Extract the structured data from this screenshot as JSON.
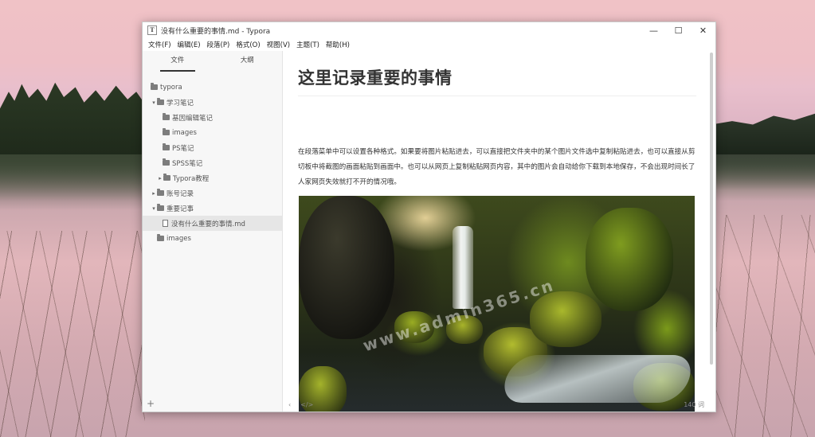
{
  "window": {
    "title": "没有什么重要的事情.md - Typora",
    "app_icon": "T",
    "controls": {
      "minimize": "—",
      "maximize": "☐",
      "close": "✕"
    }
  },
  "menu": [
    "文件(F)",
    "编辑(E)",
    "段落(P)",
    "格式(O)",
    "视图(V)",
    "主题(T)",
    "帮助(H)"
  ],
  "sidebar": {
    "tabs": [
      "文件",
      "大纲"
    ],
    "tree": [
      {
        "label": "typora",
        "level": 0,
        "caret": "",
        "type": "folder"
      },
      {
        "label": "学习笔记",
        "level": 1,
        "caret": "▾",
        "type": "folder"
      },
      {
        "label": "基因编辑笔记",
        "level": 2,
        "caret": "",
        "type": "folder"
      },
      {
        "label": "images",
        "level": 2,
        "caret": "",
        "type": "folder"
      },
      {
        "label": "PS笔记",
        "level": 2,
        "caret": "",
        "type": "folder"
      },
      {
        "label": "SPSS笔记",
        "level": 2,
        "caret": "",
        "type": "folder"
      },
      {
        "label": "Typora教程",
        "level": 2,
        "caret": "▸",
        "type": "folder"
      },
      {
        "label": "账号记录",
        "level": 1,
        "caret": "▸",
        "type": "folder"
      },
      {
        "label": "重要记事",
        "level": 1,
        "caret": "▾",
        "type": "folder"
      },
      {
        "label": "没有什么重要的事情.md",
        "level": 2,
        "caret": "",
        "type": "file",
        "selected": true
      },
      {
        "label": "images",
        "level": 1,
        "caret": "",
        "type": "folder"
      }
    ],
    "add_button": "+"
  },
  "editor": {
    "heading": "这里记录重要的事情",
    "paragraph": "在段落菜单中可以设置各种格式。如果要将图片粘贴进去，可以直接把文件夹中的某个图片文件选中复制粘贴进去，也可以直接从剪切板中将截图的画面粘贴到画面中。也可以从网页上复制粘贴网页内容，其中的图片会自动给你下载到本地保存，不会出现时间长了人家网页失效就打不开的情况哦。",
    "watermark": "www.admin365.cn"
  },
  "status": {
    "back": "‹",
    "source_toggle": "</>",
    "word_count": "140 词"
  }
}
